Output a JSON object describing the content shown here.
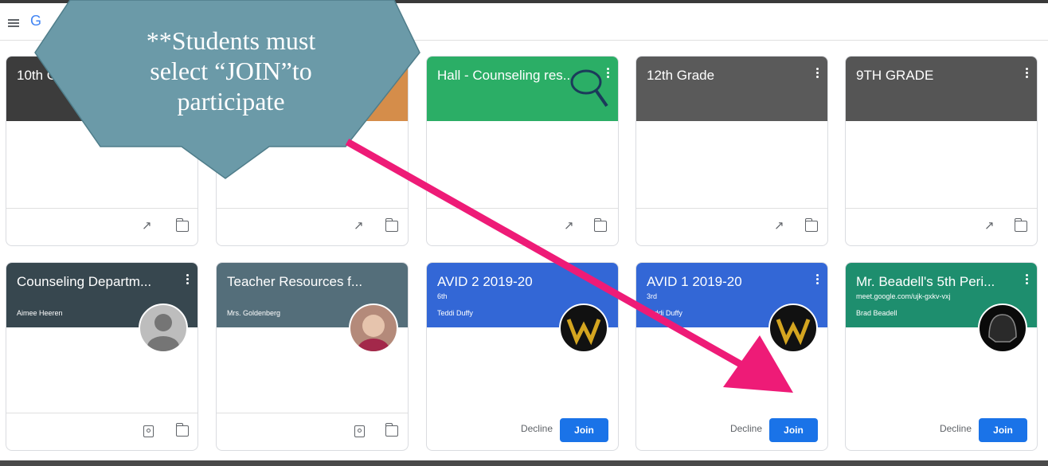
{
  "app": {
    "logo": "G"
  },
  "callout": {
    "line1": "**Students must",
    "line2": "select “JOIN”to",
    "line3": "participate"
  },
  "cards_row1": [
    {
      "title": "10th Grad",
      "color": "#3c3c3c"
    },
    {
      "title": "",
      "color": "#d58d4a"
    },
    {
      "title": "Hall - Counseling res...",
      "color": "#2bae66"
    },
    {
      "title": "12th Grade",
      "color": "#5a5a5a"
    },
    {
      "title": "9TH GRADE",
      "color": "#555555"
    }
  ],
  "cards_row2": [
    {
      "title": "Counseling Departm...",
      "sub1": "",
      "sub2": "Aimee Heeren",
      "color": "#37474f"
    },
    {
      "title": "Teacher Resources f...",
      "sub1": "",
      "sub2": "Mrs. Goldenberg",
      "color": "#546e7a"
    },
    {
      "title": "AVID 2 2019-20",
      "sub1": "6th",
      "sub2": "Teddi Duffy",
      "color": "#3367d6"
    },
    {
      "title": "AVID 1 2019-20",
      "sub1": "3rd",
      "sub2": "Teddi Duffy",
      "color": "#3367d6"
    },
    {
      "title": "Mr. Beadell's 5th Peri...",
      "sub1": "meet.google.com/ujk-gxkv-vxj",
      "sub2": "Brad Beadell",
      "color": "#1e8e6e"
    }
  ],
  "buttons": {
    "decline": "Decline",
    "join": "Join"
  },
  "colors": {
    "callout": "#6b9aa8",
    "arrow": "#ee1b77",
    "join": "#1a73e8"
  }
}
